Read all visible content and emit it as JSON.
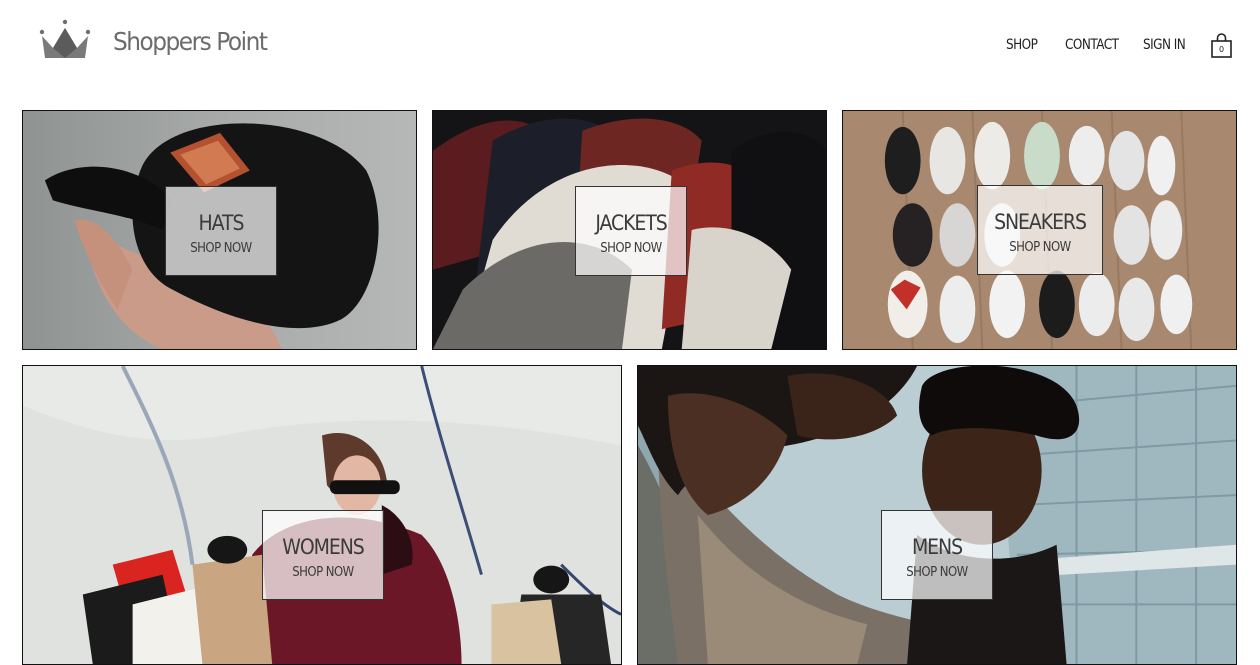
{
  "header": {
    "brand": "Shoppers Point",
    "logo_icon": "crown-icon",
    "nav": {
      "shop": "SHOP",
      "contact": "CONTACT",
      "sign_in": "SIGN IN"
    },
    "cart": {
      "icon": "shopping-bag-icon",
      "count": "0"
    }
  },
  "categories": [
    {
      "title": "HATS",
      "cta": "SHOP NOW",
      "image": "person-holding-black-cap"
    },
    {
      "title": "JACKETS",
      "cta": "SHOP NOW",
      "image": "leather-jackets-on-rack"
    },
    {
      "title": "SNEAKERS",
      "cta": "SHOP NOW",
      "image": "sneakers-on-wooden-floor"
    },
    {
      "title": "WOMENS",
      "cta": "SHOP NOW",
      "image": "woman-with-shopping-bags"
    },
    {
      "title": "MENS",
      "cta": "SHOP NOW",
      "image": "man-reaching-toward-camera"
    }
  ],
  "colors": {
    "brand_text": "#6c6c6c",
    "nav_text": "#222222",
    "tile_border": "#111111",
    "label_background": "#ffffff"
  }
}
